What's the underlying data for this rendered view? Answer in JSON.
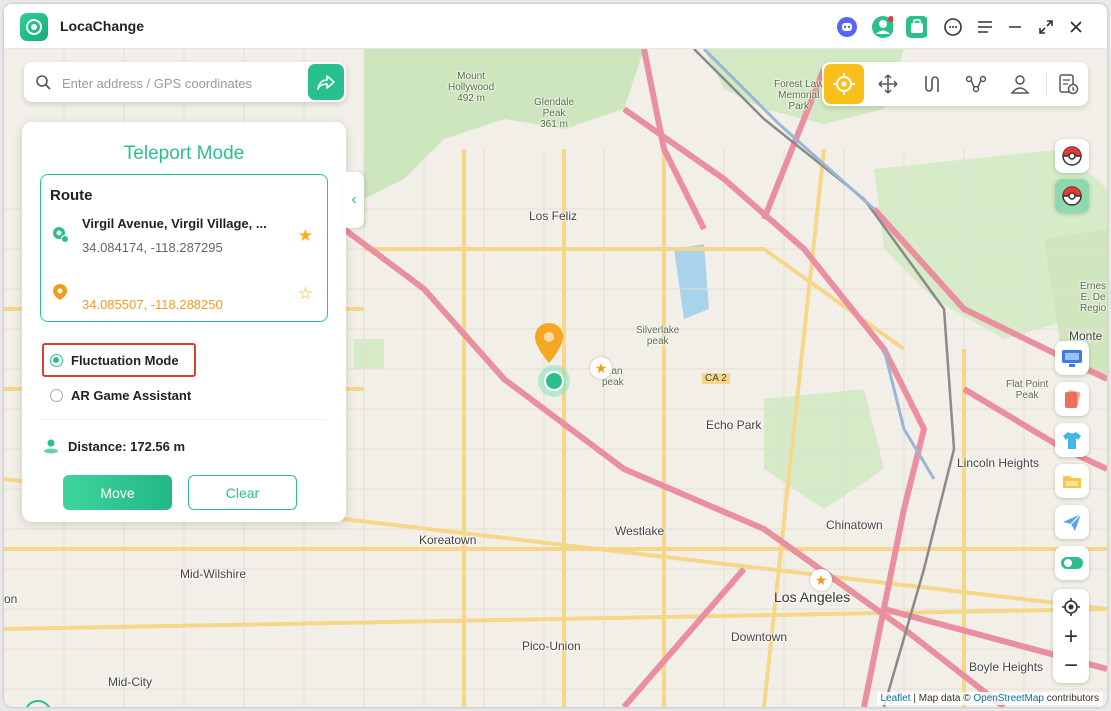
{
  "app": {
    "title": "LocaChange"
  },
  "search": {
    "placeholder": "Enter address / GPS coordinates"
  },
  "panel": {
    "title": "Teleport Mode",
    "route_label": "Route",
    "start": {
      "name": "Virgil Avenue, Virgil Village, ...",
      "coords": "34.084174, -118.287295"
    },
    "destination": {
      "coords": "34.085507, -118.288250"
    },
    "options": [
      {
        "label": "Fluctuation Mode",
        "checked": true
      },
      {
        "label": "AR Game Assistant",
        "checked": false
      }
    ],
    "distance": "Distance: 172.56 m",
    "move_label": "Move",
    "clear_label": "Clear"
  },
  "map": {
    "labels": {
      "mount_hollywood": "Mount\nHollywood\n492 m",
      "glendale_peak": "Glendale\nPeak\n361 m",
      "forest_lawn": "Forest Law\nMemorial\nPark",
      "los_feliz": "Los Feliz",
      "silverlake_peak": "Silverlake\npeak",
      "man_peak": "man\npeak",
      "echo_park": "Echo Park",
      "lincoln_heights": "Lincoln Heights",
      "flat_point": "Flat Point\nPeak",
      "monte": "Monte",
      "chinatown": "Chinatown",
      "westlake": "Westlake",
      "koreatown": "Koreatown",
      "mid_wilshire": "Mid-Wilshire",
      "los_angeles": "Los Angeles",
      "downtown": "Downtown",
      "pico_union": "Pico-Union",
      "mid_city": "Mid-City",
      "boyle_heights": "Boyle Heights",
      "on": "on",
      "ca2": "CA 2",
      "ernest": "Ernes\nE. De\nRegio"
    },
    "attribution": {
      "leaflet": "Leaflet",
      "text": " | Map data © ",
      "osm": "OpenStreetMap",
      "suffix": " contributors"
    }
  },
  "colors": {
    "accent": "#2cbf8e",
    "highlight": "#d6412f",
    "destination": "#f39a1e",
    "mode_active": "#f9c01c"
  }
}
